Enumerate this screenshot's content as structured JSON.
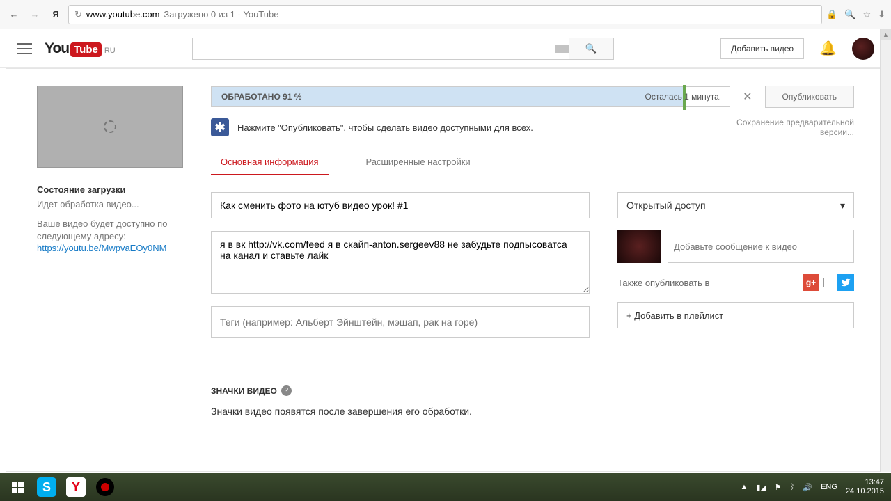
{
  "browser": {
    "url": "www.youtube.com",
    "title": "Загружено 0 из 1 - YouTube"
  },
  "header": {
    "logo_you": "You",
    "logo_tube": "Tube",
    "locale": "RU",
    "add_video": "Добавить видео"
  },
  "upload": {
    "progress_label": "ОБРАБОТАНО 91 %",
    "progress_percent": 91,
    "time_remaining": "Осталась 1 минута.",
    "publish": "Опубликовать",
    "info_hint": "Нажмите \"Опубликовать\", чтобы сделать видео доступными для всех.",
    "saving": "Сохранение предварительной версии..."
  },
  "sidebar": {
    "status_title": "Состояние загрузки",
    "status_text": "Идет обработка видео...",
    "status_desc": "Ваше видео будет доступно по следующему адресу:",
    "video_url": "https://youtu.be/MwpvaEOy0NM"
  },
  "tabs": {
    "basic": "Основная информация",
    "advanced": "Расширенные настройки"
  },
  "form": {
    "title": "Как сменить фото на ютуб видео урок! #1",
    "description": "я в вк http://vk.com/feed я в скайп-anton.sergeev88 не забудьте подпысоватса на канал и ставьте лайк",
    "tags_placeholder": "Теги (например: Альберт Эйнштейн, мэшап, рак на горе)",
    "privacy": "Открытый доступ",
    "message_placeholder": "Добавьте сообщение к видео",
    "share_label": "Также опубликовать в",
    "playlist": "+ Добавить в плейлист"
  },
  "thumbnails": {
    "title": "ЗНАЧКИ ВИДЕО",
    "text": "Значки видео появятся после завершения его обработки."
  },
  "taskbar": {
    "lang": "ENG",
    "time": "13:47",
    "date": "24.10.2015"
  }
}
